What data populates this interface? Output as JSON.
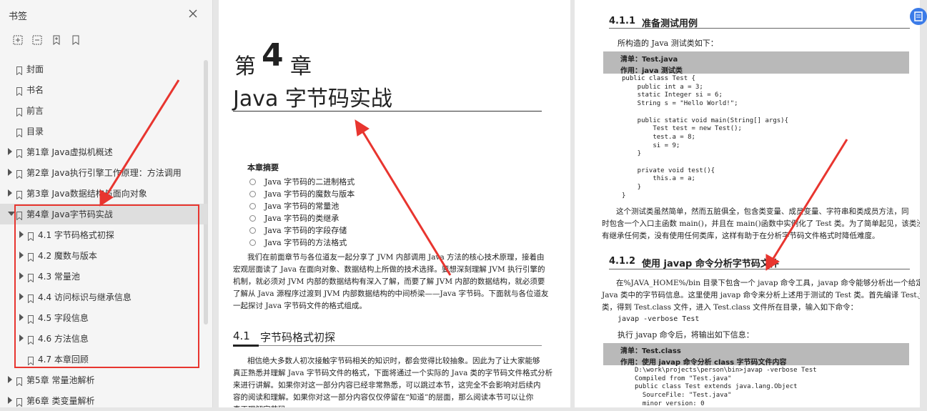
{
  "sidebar": {
    "title": "书签",
    "tools": [
      "expand-all-icon",
      "collapse-all-icon",
      "add-bookmark-icon",
      "bookmark-icon"
    ],
    "items": [
      {
        "label": "封面",
        "level": 0,
        "arrow": "none"
      },
      {
        "label": "书名",
        "level": 0,
        "arrow": "none"
      },
      {
        "label": "前言",
        "level": 0,
        "arrow": "none"
      },
      {
        "label": "目录",
        "level": 0,
        "arrow": "none"
      },
      {
        "label": "第1章 Java虚拟机概述",
        "level": 0,
        "arrow": "right"
      },
      {
        "label": "第2章 Java执行引擎工作原理：方法调用",
        "level": 0,
        "arrow": "right"
      },
      {
        "label": "第3章 Java数据结构与面向对象",
        "level": 0,
        "arrow": "right"
      },
      {
        "label": "第4章 Java字节码实战",
        "level": 0,
        "arrow": "down"
      },
      {
        "label": "4.1 字节码格式初探",
        "level": 1,
        "arrow": "right"
      },
      {
        "label": "4.2 魔数与版本",
        "level": 1,
        "arrow": "right"
      },
      {
        "label": "4.3 常量池",
        "level": 1,
        "arrow": "right"
      },
      {
        "label": "4.4 访问标识与继承信息",
        "level": 1,
        "arrow": "right"
      },
      {
        "label": "4.5 字段信息",
        "level": 1,
        "arrow": "right"
      },
      {
        "label": "4.6 方法信息",
        "level": 1,
        "arrow": "right"
      },
      {
        "label": "4.7 本章回顾",
        "level": 1,
        "arrow": "none"
      },
      {
        "label": "第5章 常量池解析",
        "level": 0,
        "arrow": "right"
      },
      {
        "label": "第6章 类变量解析",
        "level": 0,
        "arrow": "right"
      }
    ]
  },
  "left_page": {
    "chapter_pre": "第",
    "chapter_num": "4",
    "chapter_post": "章",
    "chapter_title": "Java 字节码实战",
    "summary_heading": "本章摘要",
    "summary_items": [
      "Java 字节码的二进制格式",
      "Java 字节码的魔数与版本",
      "Java 字节码的常量池",
      "Java 字节码的类继承",
      "Java 字节码的字段存储",
      "Java 字节码的方法格式"
    ],
    "intro": [
      "我们在前面章节与各位道友一起分享了 JVM 内部调用 Java 方法的核心技术原理，接着由",
      "宏观层面读了 Java 在面向对象、数据结构上所做的技术选择。要想深刻理解 JVM 执行引擎的",
      "机制，就必须对 JVM 内部的数据结构有深入了解，而要了解 JVM 内部的数据结构，就必须要",
      "了解从 Java 源程序过渡到 JVM 内部数据结构的中间桥梁——Java 字节码。下面就与各位道友",
      "一起探讨 Java 字节码文件的格式组成。"
    ],
    "section_num": "4.1",
    "section_title": "字节码格式初探",
    "section_text": [
      "相信绝大多数人初次接触字节码相关的知识时，都会觉得比较抽象。因此为了让大家能够",
      "真正熟悉并理解 Java 字节码文件的格式，下面将通过一个实际的 Java 类的字节码文件格式分析",
      "来进行讲解。如果你对这一部分内容已经非常熟悉，可以跳过本节，这完全不会影响对后续内",
      "容的阅读和理解。如果你对这一部分内容仅仅停留在“知道”的层面，那么阅读本节可以让你",
      "真正理解字节码。"
    ]
  },
  "right_page": {
    "sec1_num": "4.1.1",
    "sec1_title": "准备测试用例",
    "sec1_intro": "所构造的 Java 测试类如下：",
    "listing1_name": "清单：Test.java",
    "listing1_role": "作用：java 测试类",
    "code1": [
      "public class Test {",
      "    public int a = 3;",
      "    static Integer si = 6;",
      "    String s = \"Hello World!\";",
      "",
      "    public static void main(String[] args){",
      "        Test test = new Test();",
      "        test.a = 8;",
      "        si = 9;",
      "    }",
      "",
      "    private void test(){",
      "        this.a = a;",
      "    }",
      "}"
    ],
    "para1": [
      "这个测试类虽然简单，然而五脏俱全，包含类变量、成员变量、字符串和类成员方法，同",
      "时包含一个入口主函数 main()，并且在 main()函数中实例化了 Test 类。为了简单起见，该类没",
      "有继承任何类，没有使用任何类库，这样有助于在分析字节码文件格式时降低难度。"
    ],
    "sec2_num": "4.1.2",
    "sec2_title": "使用 javap 命令分析字节码文件",
    "para2": [
      "在%JAVA_HOME%/bin 目录下包含一个 javap 命令工具，javap 命令能够分析出一个给定的",
      "Java 类中的字节码信息。这里使用 javap 命令来分析上述用于测试的 Test 类。首先编译 Test.java",
      "类，得到 Test.class 文件，进入 Test.class 文件所在目录，输入如下命令："
    ],
    "cmd": "javap -verbose Test",
    "after_cmd": "执行 javap 命令后，将输出如下信息：",
    "listing2_name": "清单：Test.class",
    "listing2_role": "作用：使用 javap 命令分析 class 字节码文件内容",
    "code2": [
      "D:\\work\\projects\\person\\bin>javap -verbose Test",
      "Compiled from \"Test.java\"",
      "public class Test extends java.lang.Object",
      "  SourceFile: \"Test.java\"",
      "  minor version: 0"
    ]
  },
  "colors": {
    "annotation": "#e8352f",
    "accent": "#3b7be8"
  }
}
